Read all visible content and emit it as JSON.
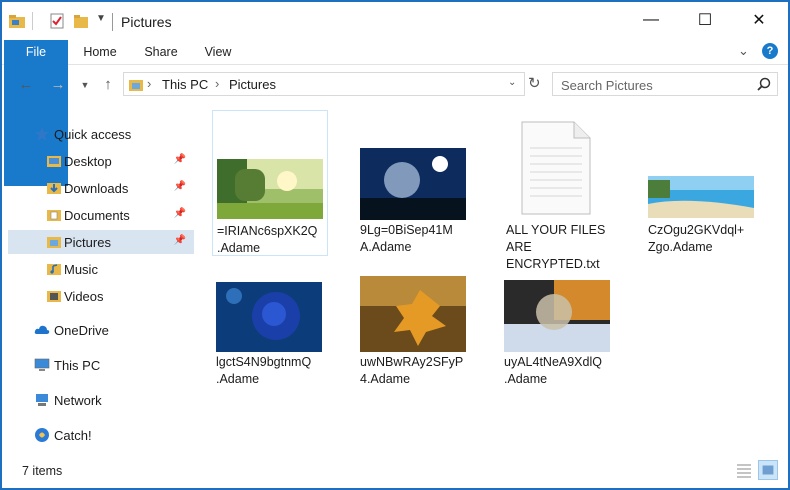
{
  "window": {
    "title": "Pictures",
    "controls": {
      "minimize": "—",
      "maximize": "☐",
      "close": "✕"
    }
  },
  "ribbon": {
    "tabs": [
      "File",
      "Home",
      "Share",
      "View"
    ],
    "help": "?"
  },
  "address": {
    "crumbs": [
      "This PC",
      "Pictures"
    ],
    "separator": "›"
  },
  "search": {
    "placeholder": "Search Pictures"
  },
  "nav": {
    "items": [
      {
        "label": "Quick access",
        "icon": "star-icon"
      },
      {
        "label": "Desktop",
        "icon": "desktop-folder-icon",
        "pinned": true
      },
      {
        "label": "Downloads",
        "icon": "downloads-folder-icon",
        "pinned": true
      },
      {
        "label": "Documents",
        "icon": "documents-folder-icon",
        "pinned": true
      },
      {
        "label": "Pictures",
        "icon": "pictures-folder-icon",
        "pinned": true,
        "selected": true
      },
      {
        "label": "Music",
        "icon": "music-folder-icon"
      },
      {
        "label": "Videos",
        "icon": "videos-folder-icon"
      },
      {
        "label": "OneDrive",
        "icon": "cloud-icon"
      },
      {
        "label": "This PC",
        "icon": "computer-icon"
      },
      {
        "label": "Network",
        "icon": "network-icon"
      },
      {
        "label": "Catch!",
        "icon": "catch-icon"
      }
    ]
  },
  "files": [
    {
      "line1": "=IRIANc6spXK2Q",
      "line2": ".Adame",
      "thumb": "green-landscape"
    },
    {
      "line1": "9Lg=0BiSep41M",
      "line2": "A.Adame",
      "thumb": "night-bubble"
    },
    {
      "line1": "ALL YOUR FILES",
      "line2": "ARE",
      "line3": "ENCRYPTED.txt",
      "thumb": "text-document-icon"
    },
    {
      "line1": "CzOgu2GKVdql+",
      "line2": "Zgo.Adame",
      "thumb": "beach"
    },
    {
      "line1": "lgctS4N9bgtnmQ",
      "line2": ".Adame",
      "thumb": "blue-rose"
    },
    {
      "line1": "uwNBwRAy2SFyP",
      "line2": "4.Adame",
      "thumb": "autumn-leaf"
    },
    {
      "line1": "uyAL4tNeA9XdlQ",
      "line2": ".Adame",
      "thumb": "snow-bubble"
    }
  ],
  "status": {
    "count": "7 items"
  },
  "colors": {
    "accent": "#1979ca",
    "selection": "#d9e4f1"
  }
}
